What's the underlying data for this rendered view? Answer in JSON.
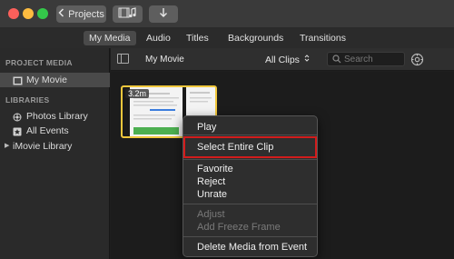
{
  "toolbar": {
    "back_label": "Projects",
    "media_icon": "media-browser-icon",
    "import_icon": "import-arrow-icon"
  },
  "tabs": [
    {
      "label": "My Media",
      "active": true
    },
    {
      "label": "Audio",
      "active": false
    },
    {
      "label": "Titles",
      "active": false
    },
    {
      "label": "Backgrounds",
      "active": false
    },
    {
      "label": "Transitions",
      "active": false
    }
  ],
  "sidebar": {
    "project_header": "PROJECT MEDIA",
    "project_item": "My Movie",
    "libraries_header": "LIBRARIES",
    "library_items": [
      {
        "label": "Photos Library",
        "icon": "photos-icon"
      },
      {
        "label": "All Events",
        "icon": "star-icon"
      },
      {
        "label": "iMovie Library",
        "icon": "disclosure-triangle-icon"
      }
    ]
  },
  "browser": {
    "title": "My Movie",
    "filter_label": "All Clips",
    "search_placeholder": "Search"
  },
  "clip": {
    "duration": "3.2m"
  },
  "context_menu": {
    "items": [
      {
        "label": "Play",
        "enabled": true
      },
      {
        "label": "Select Entire Clip",
        "enabled": true,
        "highlighted": true
      },
      {
        "label": "Favorite",
        "enabled": true
      },
      {
        "label": "Reject",
        "enabled": true
      },
      {
        "label": "Unrate",
        "enabled": true
      },
      {
        "label": "Adjust",
        "enabled": false
      },
      {
        "label": "Add Freeze Frame",
        "enabled": false
      },
      {
        "label": "Delete Media from Event",
        "enabled": true
      }
    ]
  },
  "colors": {
    "highlight_border": "#d21c1c",
    "clip_selection": "#f0c73c"
  }
}
